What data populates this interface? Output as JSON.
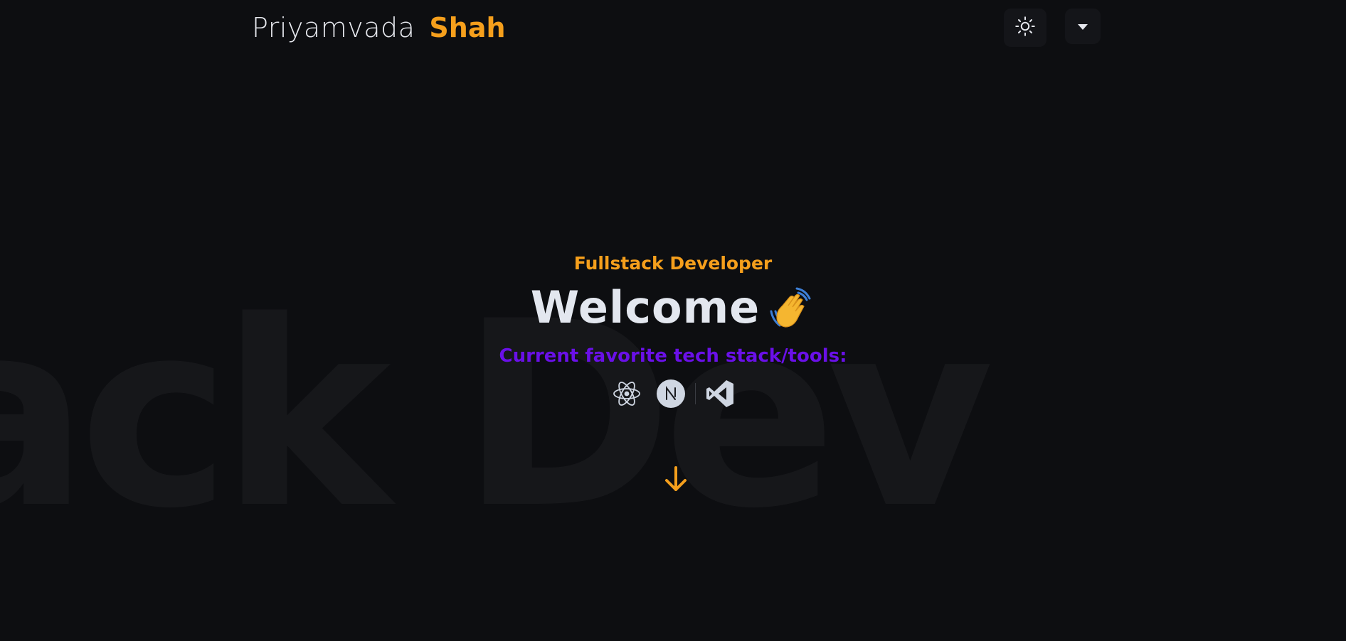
{
  "header": {
    "brand_first": "Priyamvada",
    "brand_last": "Shah",
    "theme_toggle_icon": "sun-icon",
    "menu_icon": "caret-down-icon"
  },
  "hero": {
    "background_text": "ack Dev",
    "role": "Fullstack Developer",
    "welcome": "Welcome",
    "wave_icon": "waving-hand-icon",
    "stack_label": "Current favorite tech stack/tools:",
    "stack_icons": [
      "react-icon",
      "nextjs-icon",
      "vscode-icon"
    ],
    "scroll_icon": "arrow-down-icon"
  },
  "colors": {
    "background": "#0d0e11",
    "accent_orange": "#f59f1c",
    "accent_purple": "#6a10e8",
    "text_light": "#e3e7ef"
  }
}
